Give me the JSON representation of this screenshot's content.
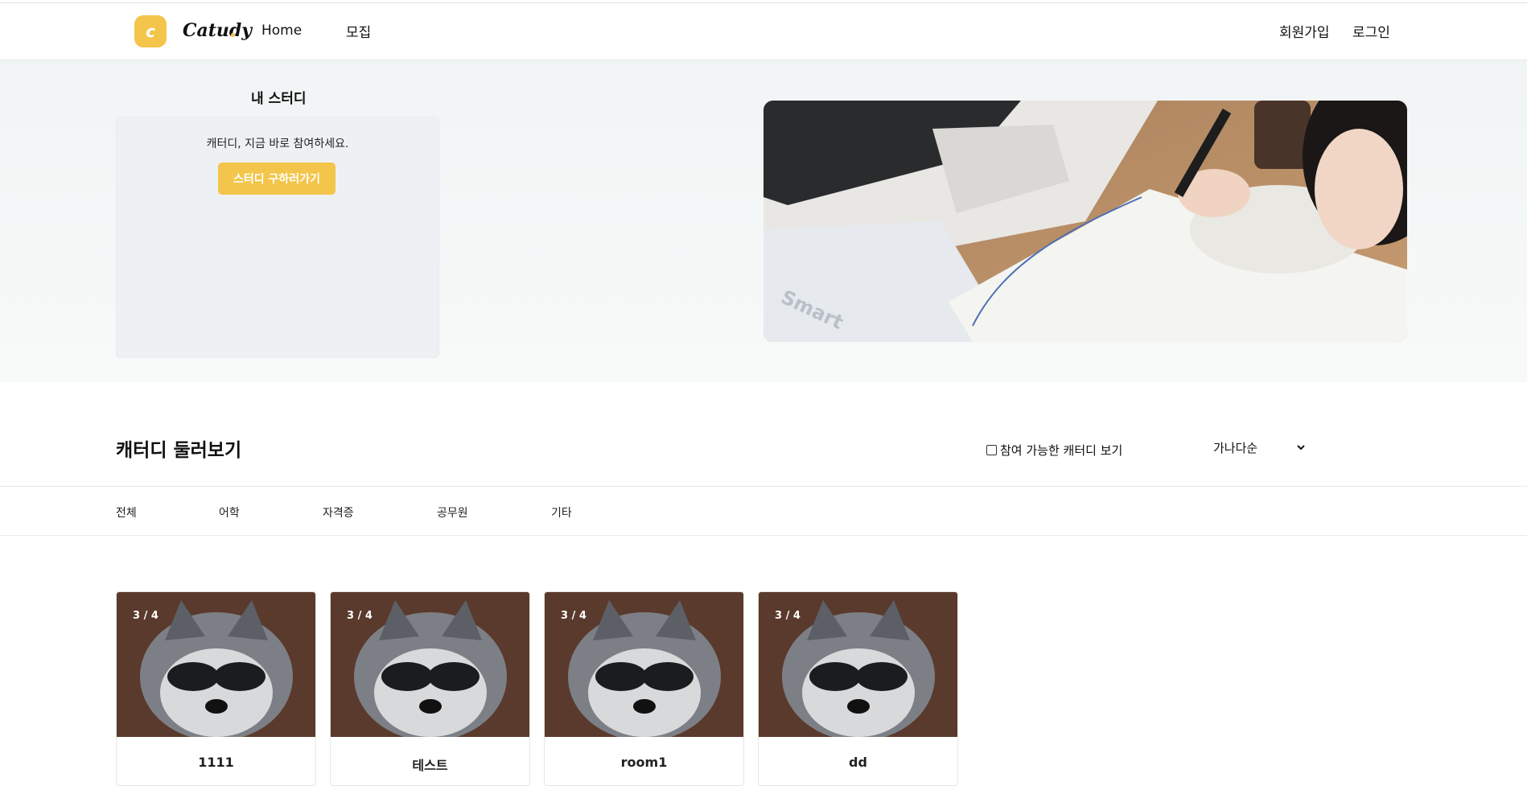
{
  "header": {
    "logo_mark": "c",
    "logo_text": "Catudy",
    "nav": {
      "home": "Home",
      "recruit": "모집"
    },
    "auth": {
      "signup": "회원가입",
      "login": "로그인"
    }
  },
  "hero": {
    "my_study_title": "내 스터디",
    "message": "캐터디, 지금 바로 참여하세요.",
    "join_button": "스터디 구하러가기"
  },
  "browse": {
    "title": "캐터디 둘러보기",
    "available_filter_label": "참여 가능한 캐터디 보기",
    "sort_selected": "가나다순"
  },
  "tabs": [
    {
      "label": "전체"
    },
    {
      "label": "어학"
    },
    {
      "label": "자격증"
    },
    {
      "label": "공무원"
    },
    {
      "label": "기타"
    }
  ],
  "cards": [
    {
      "count": "3 / 4",
      "title": "1111"
    },
    {
      "count": "3 / 4",
      "title": "테스트"
    },
    {
      "count": "3 / 4",
      "title": "room1"
    },
    {
      "count": "3 / 4",
      "title": "dd"
    }
  ],
  "colors": {
    "accent": "#f3c54a",
    "hero_bg": "#f1f4f5",
    "border": "#e3e6e8"
  }
}
